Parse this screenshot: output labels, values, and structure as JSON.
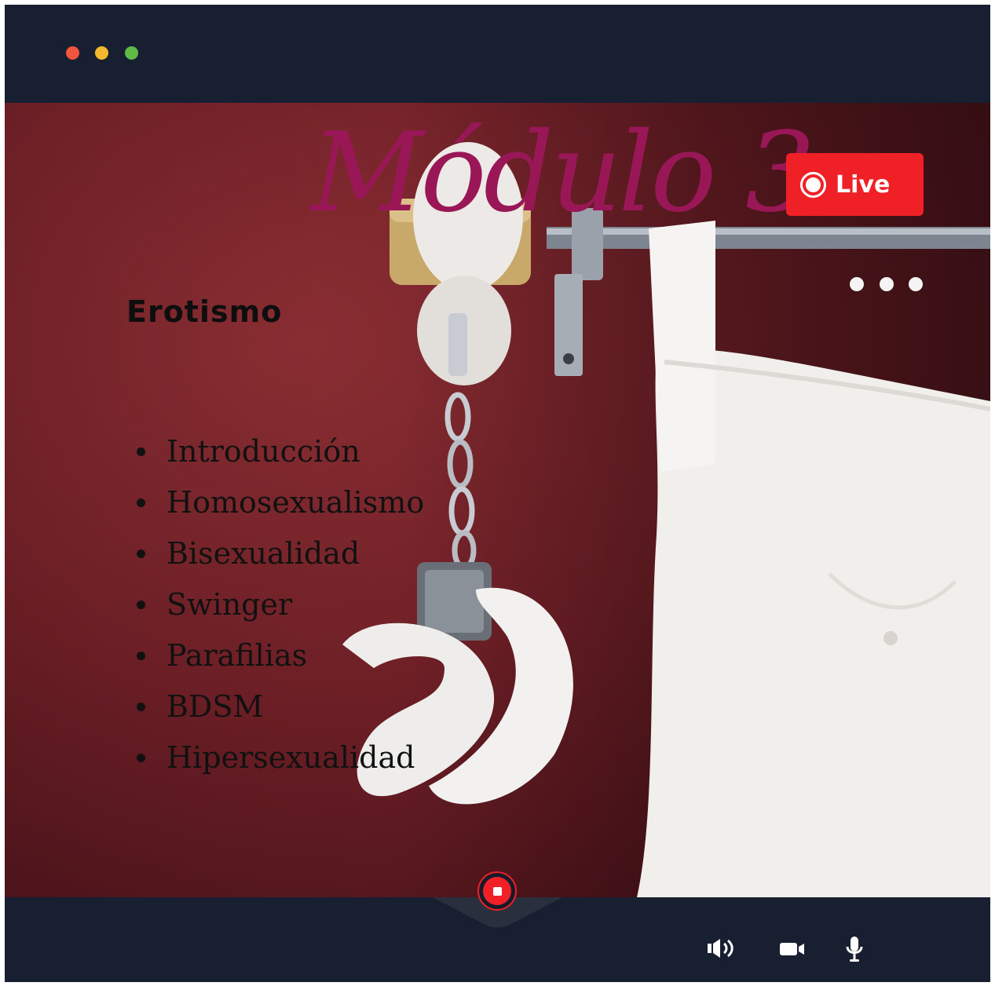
{
  "window": {
    "controls": [
      {
        "name": "close",
        "color": "#f0553e"
      },
      {
        "name": "minimize",
        "color": "#f4b92c"
      },
      {
        "name": "maximize",
        "color": "#5dbb46"
      }
    ]
  },
  "stream": {
    "live_badge": {
      "label": "Live",
      "color": "#ef2026",
      "icon": "record-icon"
    },
    "more_icon": "more-horizontal-icon",
    "title": "Módulo 3.",
    "title_color": "#9a1757",
    "subtitle": "Erotismo",
    "topics": [
      "Introducción",
      "Homosexualismo",
      "Bisexualidad",
      "Swinger",
      "Parafilias",
      "BDSM",
      "Hipersexualidad"
    ]
  },
  "controls": {
    "record_icon": "stop-record-icon",
    "volume_icon": "volume-icon",
    "camera_icon": "video-camera-icon",
    "mic_icon": "microphone-icon"
  }
}
